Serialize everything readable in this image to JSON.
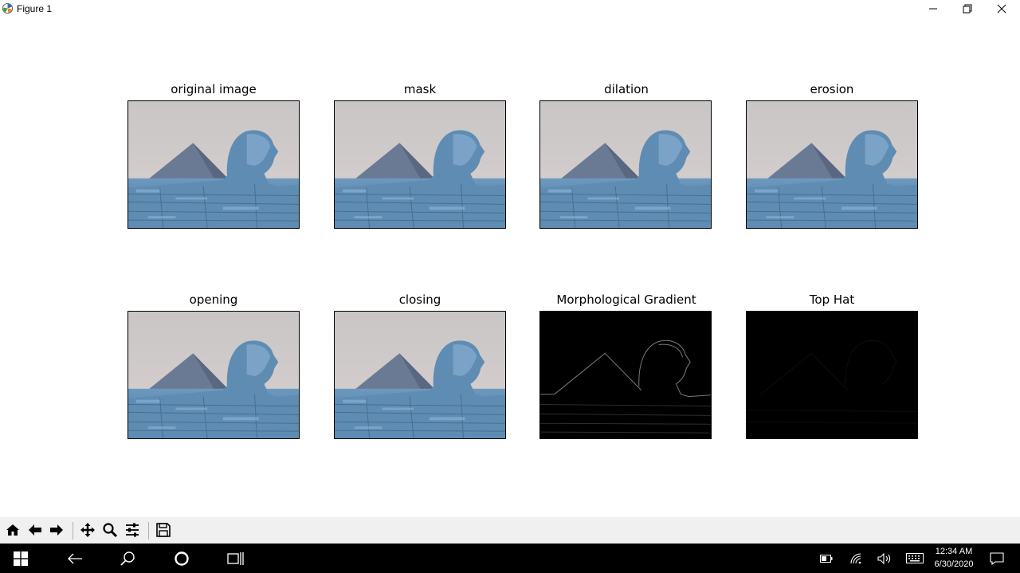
{
  "window": {
    "title": "Figure 1",
    "icons": {
      "app": "matplotlib-icon",
      "minimize": "minimize-icon",
      "restore": "restore-icon",
      "close": "close-icon"
    }
  },
  "figure": {
    "panels": [
      {
        "title": "original image",
        "image": "pyramid-sphinx-photo"
      },
      {
        "title": "mask",
        "image": "pyramid-sphinx-photo"
      },
      {
        "title": "dilation",
        "image": "pyramid-sphinx-photo"
      },
      {
        "title": "erosion",
        "image": "pyramid-sphinx-photo"
      },
      {
        "title": "opening",
        "image": "pyramid-sphinx-photo"
      },
      {
        "title": "closing",
        "image": "pyramid-sphinx-photo"
      },
      {
        "title": "Morphological Gradient",
        "image": "edge-outline-dark"
      },
      {
        "title": "Top Hat",
        "image": "near-black"
      }
    ]
  },
  "toolbar": {
    "buttons": [
      "home-icon",
      "back-arrow-icon",
      "forward-arrow-icon",
      "pan-move-icon",
      "zoom-magnifier-icon",
      "configure-subplots-icon",
      "save-disk-icon"
    ]
  },
  "taskbar": {
    "time": "12:34 AM",
    "date": "6/30/2020",
    "icons": [
      "windows-start-icon",
      "back-icon",
      "search-icon",
      "cortana-circle-icon",
      "task-view-icon",
      "battery-icon",
      "wifi-icon",
      "volume-icon",
      "keyboard-icon",
      "notifications-icon"
    ]
  },
  "colors": {
    "toolbar_bg": "#f0f0f0",
    "taskbar_bg": "#000000",
    "sky": "#cfcbc9",
    "sphinx_blue": "#5b86aa"
  }
}
